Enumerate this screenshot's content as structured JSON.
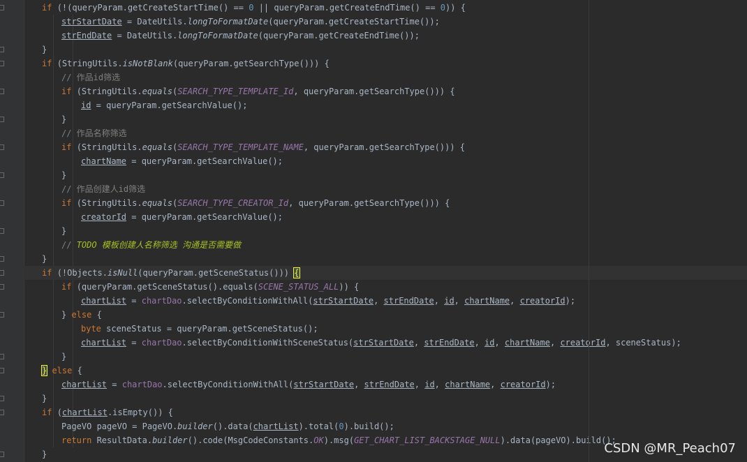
{
  "editor": {
    "lines": [
      {
        "indent": 1,
        "fold": true,
        "tokens": [
          [
            "kw",
            "if "
          ],
          [
            "p",
            "(!(queryParam.getCreateStartTime() == "
          ],
          [
            "num",
            "0"
          ],
          [
            "p",
            " || queryParam.getCreateEndTime() == "
          ],
          [
            "num",
            "0"
          ],
          [
            "p",
            ")) {"
          ]
        ]
      },
      {
        "indent": 2,
        "fold": false,
        "tokens": [
          [
            "var",
            "strStartDate"
          ],
          [
            "p",
            " = DateUtils."
          ],
          [
            "st",
            "longToFormatDate"
          ],
          [
            "p",
            "(queryParam.getCreateStartTime());"
          ]
        ]
      },
      {
        "indent": 2,
        "fold": false,
        "tokens": [
          [
            "var",
            "strEndDate"
          ],
          [
            "p",
            " = DateUtils."
          ],
          [
            "st",
            "longToFormatDate"
          ],
          [
            "p",
            "(queryParam.getCreateEndTime());"
          ]
        ]
      },
      {
        "indent": 1,
        "fold": true,
        "tokens": [
          [
            "p",
            "}"
          ]
        ]
      },
      {
        "indent": 1,
        "fold": true,
        "tokens": [
          [
            "kw",
            "if "
          ],
          [
            "p",
            "(StringUtils."
          ],
          [
            "st",
            "isNotBlank"
          ],
          [
            "p",
            "(queryParam.getSearchType())) {"
          ]
        ]
      },
      {
        "indent": 2,
        "fold": false,
        "tokens": [
          [
            "cm",
            "// 作品id筛选"
          ]
        ]
      },
      {
        "indent": 2,
        "fold": true,
        "tokens": [
          [
            "kw",
            "if "
          ],
          [
            "p",
            "(StringUtils."
          ],
          [
            "st",
            "equals"
          ],
          [
            "p",
            "("
          ],
          [
            "cst",
            "SEARCH_TYPE_TEMPLATE_Id"
          ],
          [
            "p",
            ", queryParam.getSearchType())) {"
          ]
        ]
      },
      {
        "indent": 3,
        "fold": false,
        "tokens": [
          [
            "var",
            "id"
          ],
          [
            "p",
            " = queryParam.getSearchValue();"
          ]
        ]
      },
      {
        "indent": 2,
        "fold": true,
        "tokens": [
          [
            "p",
            "}"
          ]
        ]
      },
      {
        "indent": 2,
        "fold": false,
        "tokens": [
          [
            "cm",
            "// 作品名称筛选"
          ]
        ]
      },
      {
        "indent": 2,
        "fold": true,
        "tokens": [
          [
            "kw",
            "if "
          ],
          [
            "p",
            "(StringUtils."
          ],
          [
            "st",
            "equals"
          ],
          [
            "p",
            "("
          ],
          [
            "cst",
            "SEARCH_TYPE_TEMPLATE_NAME"
          ],
          [
            "p",
            ", queryParam.getSearchType())) {"
          ]
        ]
      },
      {
        "indent": 3,
        "fold": false,
        "tokens": [
          [
            "var",
            "chartName"
          ],
          [
            "p",
            " = queryParam.getSearchValue();"
          ]
        ]
      },
      {
        "indent": 2,
        "fold": true,
        "tokens": [
          [
            "p",
            "}"
          ]
        ]
      },
      {
        "indent": 2,
        "fold": false,
        "tokens": [
          [
            "cm",
            "// 作品创建人id筛选"
          ]
        ]
      },
      {
        "indent": 2,
        "fold": true,
        "tokens": [
          [
            "kw",
            "if "
          ],
          [
            "p",
            "(StringUtils."
          ],
          [
            "st",
            "equals"
          ],
          [
            "p",
            "("
          ],
          [
            "cst",
            "SEARCH_TYPE_CREATOR_Id"
          ],
          [
            "p",
            ", queryParam.getSearchType())) {"
          ]
        ]
      },
      {
        "indent": 3,
        "fold": false,
        "tokens": [
          [
            "var",
            "creatorId"
          ],
          [
            "p",
            " = queryParam.getSearchValue();"
          ]
        ]
      },
      {
        "indent": 2,
        "fold": true,
        "tokens": [
          [
            "p",
            "}"
          ]
        ]
      },
      {
        "indent": 2,
        "fold": false,
        "tokens": [
          [
            "cm",
            "// "
          ],
          [
            "todo",
            "TODO 模板创建人名称筛选 沟通是否需要做"
          ]
        ]
      },
      {
        "indent": 1,
        "fold": true,
        "tokens": [
          [
            "p",
            "}"
          ]
        ]
      },
      {
        "indent": 1,
        "fold": true,
        "caret": true,
        "tokens": [
          [
            "kw",
            "if "
          ],
          [
            "p",
            "(!Objects."
          ],
          [
            "st",
            "isNull"
          ],
          [
            "p",
            "(queryParam.getSceneStatus())) "
          ],
          [
            "brm",
            "{"
          ]
        ]
      },
      {
        "indent": 2,
        "fold": true,
        "tokens": [
          [
            "kw",
            "if "
          ],
          [
            "p",
            "(queryParam.getSceneStatus().equals("
          ],
          [
            "cst",
            "SCENE_STATUS_ALL"
          ],
          [
            "p",
            ")) {"
          ]
        ]
      },
      {
        "indent": 3,
        "fold": false,
        "tokens": [
          [
            "var",
            "chartList"
          ],
          [
            "p",
            " = "
          ],
          [
            "fld",
            "chartDao"
          ],
          [
            "p",
            ".selectByConditionWithAll("
          ],
          [
            "var",
            "strStartDate"
          ],
          [
            "p",
            ", "
          ],
          [
            "var",
            "strEndDate"
          ],
          [
            "p",
            ", "
          ],
          [
            "var",
            "id"
          ],
          [
            "p",
            ", "
          ],
          [
            "var",
            "chartName"
          ],
          [
            "p",
            ", "
          ],
          [
            "var",
            "creatorId"
          ],
          [
            "p",
            ");"
          ]
        ]
      },
      {
        "indent": 2,
        "fold": true,
        "tokens": [
          [
            "p",
            "} "
          ],
          [
            "kw",
            "else "
          ],
          [
            "p",
            "{"
          ]
        ]
      },
      {
        "indent": 3,
        "fold": false,
        "tokens": [
          [
            "kw",
            "byte "
          ],
          [
            "p",
            "sceneStatus = queryParam.getSceneStatus();"
          ]
        ]
      },
      {
        "indent": 3,
        "fold": false,
        "tokens": [
          [
            "var",
            "chartList"
          ],
          [
            "p",
            " = "
          ],
          [
            "fld",
            "chartDao"
          ],
          [
            "p",
            ".selectByConditionWithSceneStatus("
          ],
          [
            "var",
            "strStartDate"
          ],
          [
            "p",
            ", "
          ],
          [
            "var",
            "strEndDate"
          ],
          [
            "p",
            ", "
          ],
          [
            "var",
            "id"
          ],
          [
            "p",
            ", "
          ],
          [
            "var",
            "chartName"
          ],
          [
            "p",
            ", "
          ],
          [
            "var",
            "creatorId"
          ],
          [
            "p",
            ", sceneStatus);"
          ]
        ]
      },
      {
        "indent": 2,
        "fold": true,
        "tokens": [
          [
            "p",
            "}"
          ]
        ]
      },
      {
        "indent": 1,
        "fold": true,
        "tokens": [
          [
            "brm",
            "}"
          ],
          [
            "kw",
            " else "
          ],
          [
            "p",
            "{"
          ]
        ]
      },
      {
        "indent": 2,
        "fold": false,
        "tokens": [
          [
            "var",
            "chartList"
          ],
          [
            "p",
            " = "
          ],
          [
            "fld",
            "chartDao"
          ],
          [
            "p",
            ".selectByConditionWithAll("
          ],
          [
            "var",
            "strStartDate"
          ],
          [
            "p",
            ", "
          ],
          [
            "var",
            "strEndDate"
          ],
          [
            "p",
            ", "
          ],
          [
            "var",
            "id"
          ],
          [
            "p",
            ", "
          ],
          [
            "var",
            "chartName"
          ],
          [
            "p",
            ", "
          ],
          [
            "var",
            "creatorId"
          ],
          [
            "p",
            ");"
          ]
        ]
      },
      {
        "indent": 1,
        "fold": true,
        "tokens": [
          [
            "p",
            "}"
          ]
        ]
      },
      {
        "indent": 1,
        "fold": true,
        "tokens": [
          [
            "kw",
            "if "
          ],
          [
            "p",
            "("
          ],
          [
            "var",
            "chartList"
          ],
          [
            "p",
            ".isEmpty()) {"
          ]
        ]
      },
      {
        "indent": 2,
        "fold": false,
        "tokens": [
          [
            "p",
            "PageVO pageVO = PageVO."
          ],
          [
            "st",
            "builder"
          ],
          [
            "p",
            "().data("
          ],
          [
            "var",
            "chartList"
          ],
          [
            "p",
            ").total("
          ],
          [
            "num",
            "0"
          ],
          [
            "p",
            ").build();"
          ]
        ]
      },
      {
        "indent": 2,
        "fold": false,
        "tokens": [
          [
            "kw",
            "return "
          ],
          [
            "p",
            "ResultData."
          ],
          [
            "st",
            "builder"
          ],
          [
            "p",
            "().code(MsgCodeConstants."
          ],
          [
            "cst",
            "OK"
          ],
          [
            "p",
            ").msg("
          ],
          [
            "cst",
            "GET_CHART_LIST_BACKSTAGE_NULL"
          ],
          [
            "p",
            ").data(pageVO).build();"
          ]
        ]
      },
      {
        "indent": 1,
        "fold": true,
        "tokens": [
          [
            "p",
            "}"
          ]
        ]
      }
    ]
  },
  "watermark": "CSDN @MR_Peach07"
}
